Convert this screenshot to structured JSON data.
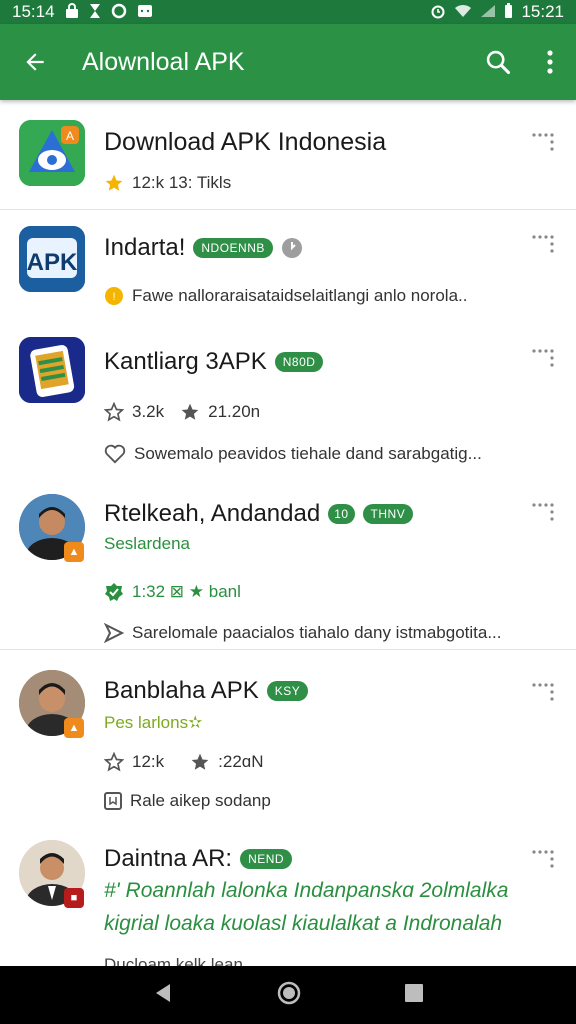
{
  "status_bar": {
    "time_left": "15:14",
    "time_right": "15:21"
  },
  "app_bar": {
    "title": "Alownloal APK"
  },
  "header_item": {
    "title": "Download APK Indonesia",
    "meta": "12:k 13: Tikls"
  },
  "items": [
    {
      "title": "Indarta!",
      "chip": "NDOENNB",
      "desc": "Fawe nalloraraisataidselaitlangi anlo norola.."
    },
    {
      "title": "Kantliarg 3APK",
      "chip": "N80D",
      "stat1": "3.2k",
      "stat2": "21.20n",
      "desc": "Sowemalo peavidos tiehale dand sarabgatig..."
    },
    {
      "title": "Rtelkeah, Andandad",
      "chip_small": "10",
      "chip": "THNV",
      "subtitle": "Seslardena",
      "stat": "1:32 ⊠ ★ banl",
      "desc": "Sarelomale paacialos tiahalo dany istmabgotita..."
    },
    {
      "title": "Banblaha APK",
      "chip": "KSY",
      "subtitle": "Pes larlons✫",
      "stat1": "12:k",
      "stat2": ":22ɑN",
      "desc": "Rale aikep sodanp"
    },
    {
      "title": "Daintna AR:",
      "chip": "NEND",
      "desc_line1": "#' Roannlah lalonka Indanpanskɑ 2olmlalka",
      "desc_line2": "kigrial loaka kuolasl kiaulalkat a Indronalah",
      "cutoff": "Ducloam kelk lean"
    }
  ],
  "colors": {
    "status_bar": "#1e7a3c",
    "app_bar": "#2a9145",
    "chip": "#2f8f46",
    "accent_orange": "#ef8a1c",
    "star": "#f4b400"
  }
}
